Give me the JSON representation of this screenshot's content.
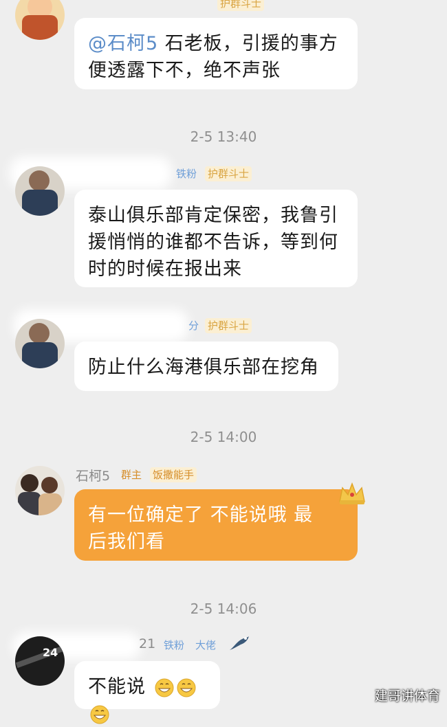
{
  "messages": [
    {
      "mention": "@石柯5",
      "text_line1": " 石老板，引援的事方",
      "text_line2": "便透露下不，绝不声张"
    },
    {
      "time": "2-5 13:40"
    },
    {
      "tags": [
        "铁粉",
        "护群斗士"
      ],
      "lines": [
        "泰山俱乐部肯定保密，我鲁引",
        "援悄悄的谁都不告诉，等到何",
        "时的时候在报出来"
      ]
    },
    {
      "tags": [
        "分",
        "护群斗士"
      ],
      "lines": [
        "防止什么海港俱乐部在挖角"
      ]
    },
    {
      "time": "2-5 14:00"
    },
    {
      "name": "石柯5",
      "tags": [
        "群主",
        "饭撒能手"
      ],
      "lines": [
        "有一位确定了  不能说哦  最",
        "后我们看"
      ]
    },
    {
      "time": "2-5 14:06"
    },
    {
      "name_fragment": "21",
      "tags": [
        "铁粉",
        "大佬"
      ],
      "text": "不能说"
    }
  ],
  "top_tag": "护群斗士",
  "watermark": "建哥讲体育",
  "colors": {
    "orange_bubble": "#f5a23a",
    "background": "#eeeeee",
    "mention": "#5b8cc8"
  }
}
